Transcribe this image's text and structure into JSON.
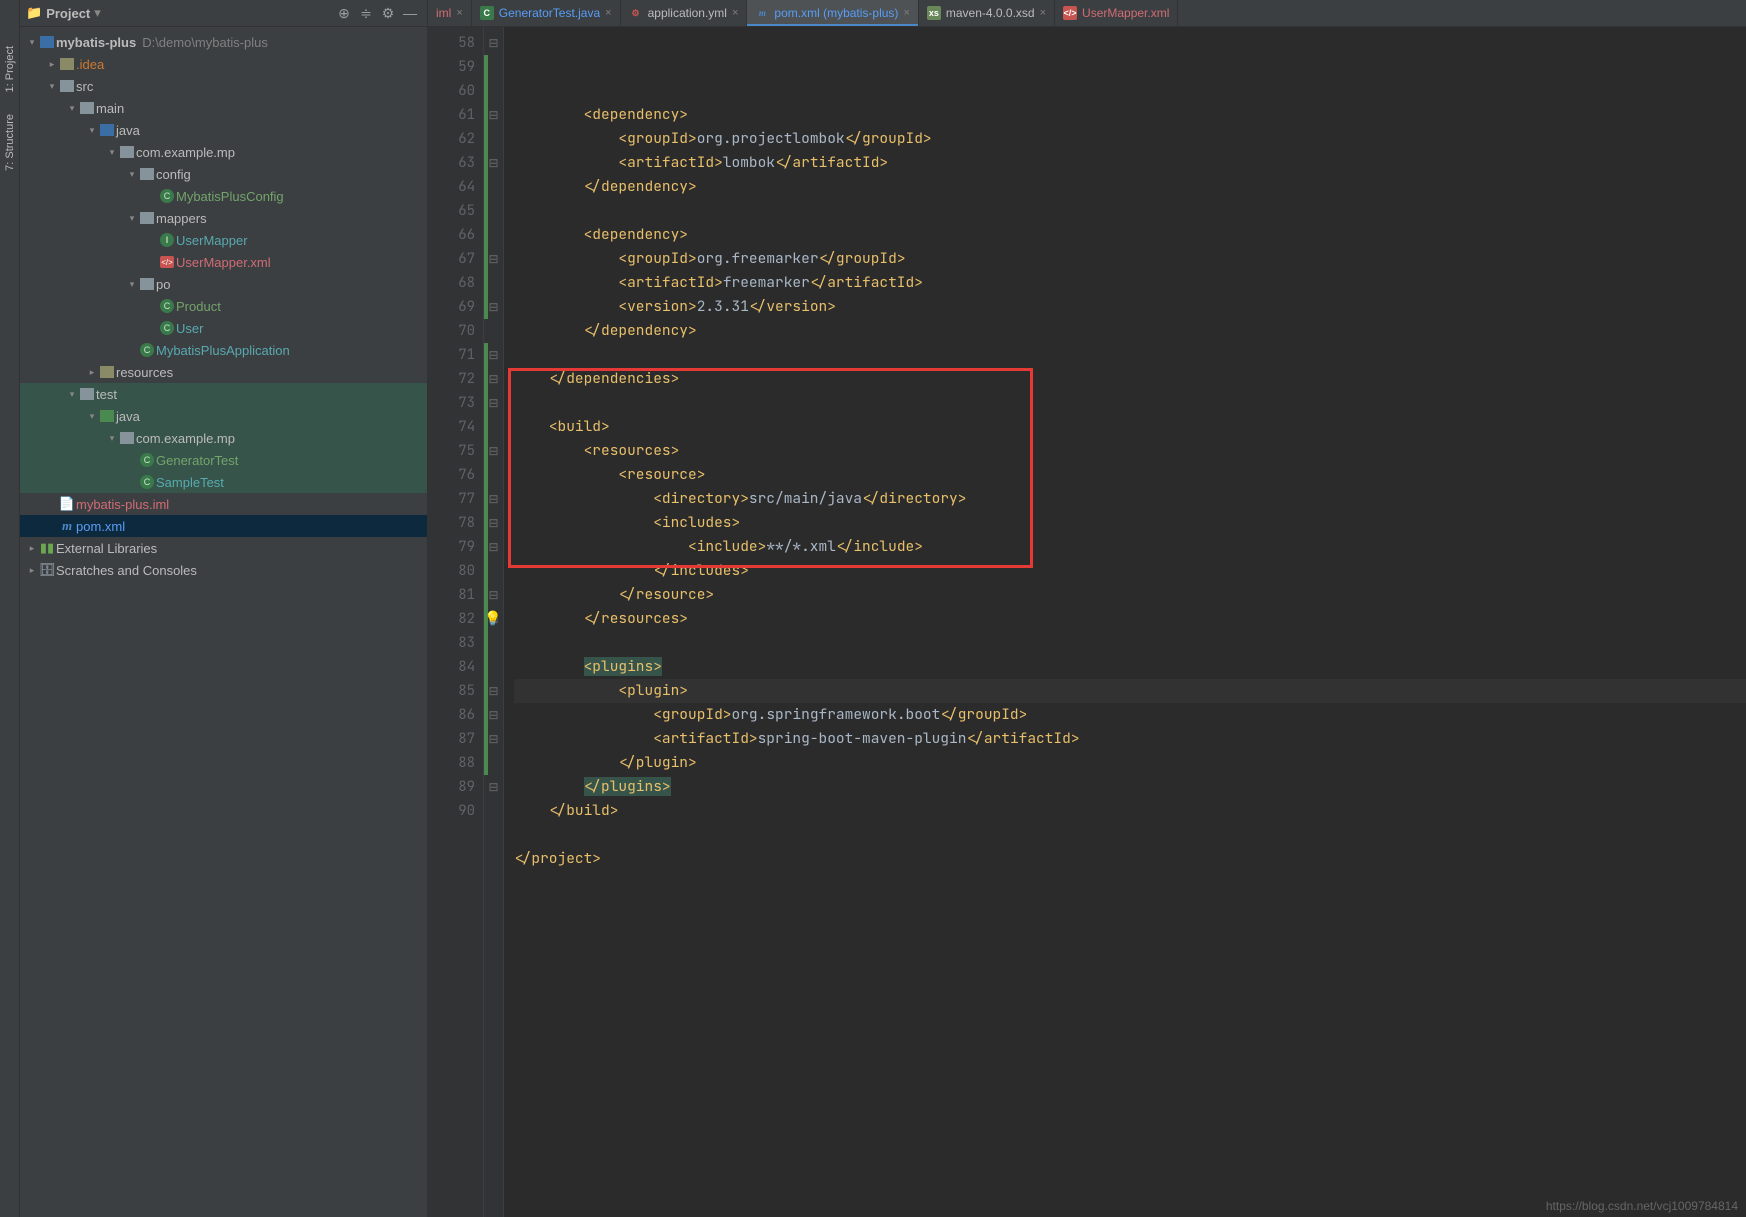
{
  "leftStrip": {
    "project": "1: Project",
    "structure": "7: Structure"
  },
  "sidebar": {
    "title": "Project",
    "root": {
      "name": "mybatis-plus",
      "path": "D:\\demo\\mybatis-plus"
    },
    "nodes": {
      "idea": ".idea",
      "src": "src",
      "main": "main",
      "java1": "java",
      "pkg1": "com.example.mp",
      "config": "config",
      "mpConfig": "MybatisPlusConfig",
      "mappers": "mappers",
      "userMapper": "UserMapper",
      "userMapperXml": "UserMapper.xml",
      "po": "po",
      "product": "Product",
      "user": "User",
      "app": "MybatisPlusApplication",
      "resources": "resources",
      "test": "test",
      "java2": "java",
      "pkg2": "com.example.mp",
      "genTest": "GeneratorTest",
      "sampleTest": "SampleTest",
      "iml": "mybatis-plus.iml",
      "pom": "pom.xml",
      "ext": "External Libraries",
      "scratch": "Scratches and Consoles"
    }
  },
  "tabs": [
    {
      "label": "iml",
      "kind": "iml"
    },
    {
      "label": "GeneratorTest.java",
      "kind": "java-mod"
    },
    {
      "label": "application.yml",
      "kind": "yml"
    },
    {
      "label": "pom.xml (mybatis-plus)",
      "kind": "pom",
      "active": true
    },
    {
      "label": "maven-4.0.0.xsd",
      "kind": "xsd"
    },
    {
      "label": "UserMapper.xml",
      "kind": "xml-red"
    }
  ],
  "editor": {
    "startLine": 58,
    "lines": [
      "        <dependency>",
      "            <groupId>org.projectlombok</groupId>",
      "            <artifactId>lombok</artifactId>",
      "        </dependency>",
      "",
      "        <dependency>",
      "            <groupId>org.freemarker</groupId>",
      "            <artifactId>freemarker</artifactId>",
      "            <version>2.3.31</version>",
      "        </dependency>",
      "",
      "    </dependencies>",
      "",
      "    <build>",
      "        <resources>",
      "            <resource>",
      "                <directory>src/main/java</directory>",
      "                <includes>",
      "                    <include>**/*.xml</include>",
      "                </includes>",
      "            </resource>",
      "        </resources>",
      "",
      "        <plugins>",
      "            <plugin>",
      "                <groupId>org.springframework.boot</groupId>",
      "                <artifactId>spring-boot-maven-plugin</artifactId>",
      "            </plugin>",
      "        </plugins>",
      "    </build>",
      "",
      "</project>",
      ""
    ],
    "currentLine": 82
  },
  "watermark": "https://blog.csdn.net/vcj1009784814"
}
